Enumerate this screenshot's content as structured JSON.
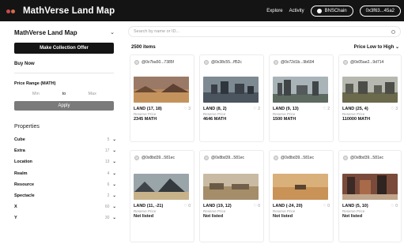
{
  "app": {
    "title": "MathVerse Land Map"
  },
  "nav": {
    "explore": "Explore",
    "activity": "Activity",
    "chain": "BNSChain",
    "wallet": "0x3f63...45a2"
  },
  "sidebar": {
    "title": "MathVerse Land Map",
    "make_offer": "Make Collection Offer",
    "buy_now": "Buy Now",
    "price_range_label": "Price Range (MATH)",
    "min_placeholder": "Min",
    "to": "to",
    "max_placeholder": "Max",
    "apply": "Apply",
    "properties_title": "Properties",
    "properties": [
      {
        "name": "Cube",
        "count": "5"
      },
      {
        "name": "Extra",
        "count": "17"
      },
      {
        "name": "Location",
        "count": "13"
      },
      {
        "name": "Realm",
        "count": "4"
      },
      {
        "name": "Resource",
        "count": "6"
      },
      {
        "name": "Spectacle",
        "count": "2"
      },
      {
        "name": "X",
        "count": "60"
      },
      {
        "name": "Y",
        "count": "30"
      }
    ]
  },
  "main": {
    "search_placeholder": "Search by name or ID...",
    "items_count": "2500 items",
    "sort": "Price Low to High",
    "cards": [
      {
        "owner": "@0x7ba50...7385f",
        "name": "LAND (17, 18)",
        "likes": "3",
        "price_label": "Reserve Price",
        "price": "2345 MATH"
      },
      {
        "owner": "@0x38c55...ff52c",
        "name": "LAND (8, 2)",
        "likes": "2",
        "price_label": "Reserve Price",
        "price": "4646 MATH"
      },
      {
        "owner": "@0x72d1b...9b604",
        "name": "LAND (9, 13)",
        "likes": "2",
        "price_label": "Reserve Price",
        "price": "1500 MATH"
      },
      {
        "owner": "@0x05ae2...9d714",
        "name": "LAND (25, 4)",
        "likes": "3",
        "price_label": "Reserve Price",
        "price": "110000 MATH"
      },
      {
        "owner": "@0x8bd39...581ec",
        "name": "LAND (11, -21)",
        "likes": "0",
        "price_label": "Reserve Price",
        "price": "Not listed"
      },
      {
        "owner": "@0x8bd39...581ec",
        "name": "LAND (19, 12)",
        "likes": "0",
        "price_label": "Reserve Price",
        "price": "Not listed"
      },
      {
        "owner": "@0x8bd39...581ec",
        "name": "LAND (-24, 20)",
        "likes": "0",
        "price_label": "Reserve Price",
        "price": "Not listed"
      },
      {
        "owner": "@0x8bd39...581ec",
        "name": "LAND (5, 10)",
        "likes": "0",
        "price_label": "Reserve Price",
        "price": "Not listed"
      }
    ]
  }
}
